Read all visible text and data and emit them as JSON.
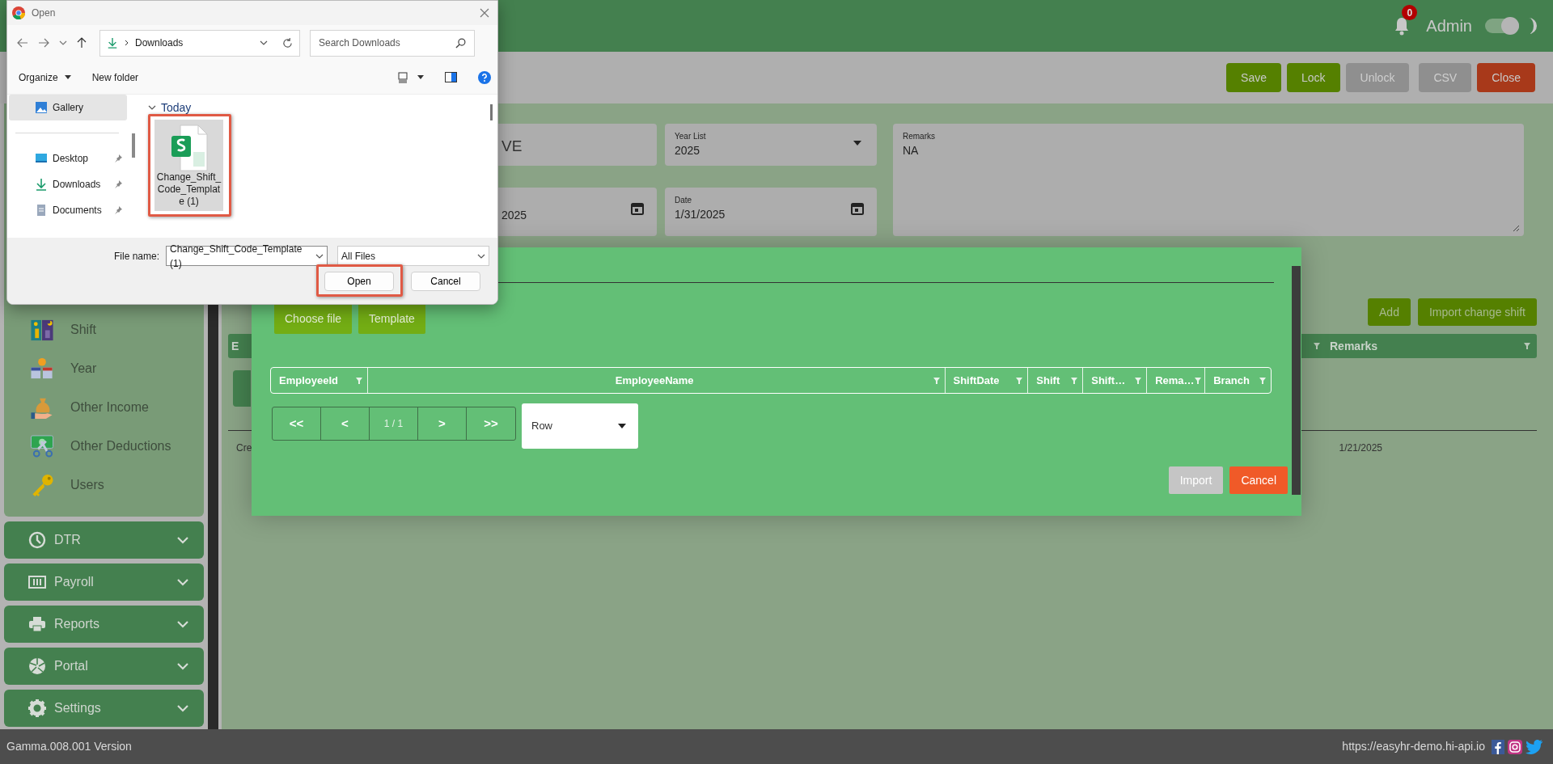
{
  "header": {
    "notifications": "0",
    "user": "Admin",
    "theme_toggle": {
      "on": true
    }
  },
  "toolbar": [
    {
      "label": "Save",
      "kind": "confirm",
      "disabled": false
    },
    {
      "label": "Lock",
      "kind": "confirm",
      "disabled": false
    },
    {
      "label": "Unlock",
      "disabled": true
    },
    {
      "label": "CSV",
      "disabled": true
    },
    {
      "label": "Close",
      "kind": "danger",
      "disabled": false
    }
  ],
  "sidebar": {
    "items": [
      {
        "label": "Shift"
      },
      {
        "label": "Year"
      },
      {
        "label": "Other Income"
      },
      {
        "label": "Other Deductions"
      },
      {
        "label": "Users"
      }
    ],
    "sections": [
      {
        "label": "DTR"
      },
      {
        "label": "Payroll"
      },
      {
        "label": "Reports"
      },
      {
        "label": "Portal"
      },
      {
        "label": "Settings"
      }
    ]
  },
  "form": {
    "fields": [
      {
        "kind": "text",
        "value": "VE"
      },
      {
        "kind": "select",
        "label": "Year List",
        "value": "2025"
      },
      {
        "kind": "date",
        "value": "2025"
      },
      {
        "kind": "date",
        "label": "Date",
        "value": "1/31/2025"
      },
      {
        "kind": "textarea",
        "label": "Remarks",
        "value": "NA"
      }
    ]
  },
  "actions": [
    "Add",
    "Import change shift"
  ],
  "table": {
    "columns": [
      "E",
      "Remarks"
    ],
    "rows": [
      [
        "Cre",
        "1/21/2025"
      ]
    ]
  },
  "modal": {
    "buttons": [
      "Choose file",
      "Template"
    ],
    "columns": [
      "EmployeeId",
      "EmployeeName",
      "ShiftDate",
      "Shift",
      "Shift…",
      "Rema…",
      "Branch"
    ],
    "pager": [
      "<<",
      "<",
      "1 / 1",
      ">",
      ">>"
    ],
    "page_size": {
      "value": "Row"
    },
    "footer_buttons": [
      {
        "label": "Import",
        "kind": "muted"
      },
      {
        "label": "Cancel",
        "kind": "danger"
      }
    ]
  },
  "file_dialog": {
    "title": "Open",
    "path": "Downloads",
    "search": {
      "placeholder": "Search Downloads"
    },
    "toolbar": [
      "Organize",
      "New folder"
    ],
    "nav": [
      {
        "label": "Gallery",
        "selected": true,
        "pinned": false
      },
      {
        "label": "Desktop",
        "selected": false,
        "pinned": true
      },
      {
        "label": "Downloads",
        "selected": false,
        "pinned": true
      },
      {
        "label": "Documents",
        "selected": false,
        "pinned": true
      }
    ],
    "group": "Today",
    "files": [
      {
        "name": "Change_Shift_Code_Template (1)",
        "selected": true,
        "highlighted": true
      }
    ],
    "file_name_label": "File name:",
    "file_name": "Change_Shift_Code_Template (1)",
    "file_type": "All Files",
    "buttons": [
      {
        "label": "Open",
        "highlighted": true
      },
      {
        "label": "Cancel",
        "highlighted": false
      }
    ]
  },
  "footer": {
    "version": "Gamma.008.001 Version",
    "url": "https://easyhr-demo.hi-api.io"
  }
}
